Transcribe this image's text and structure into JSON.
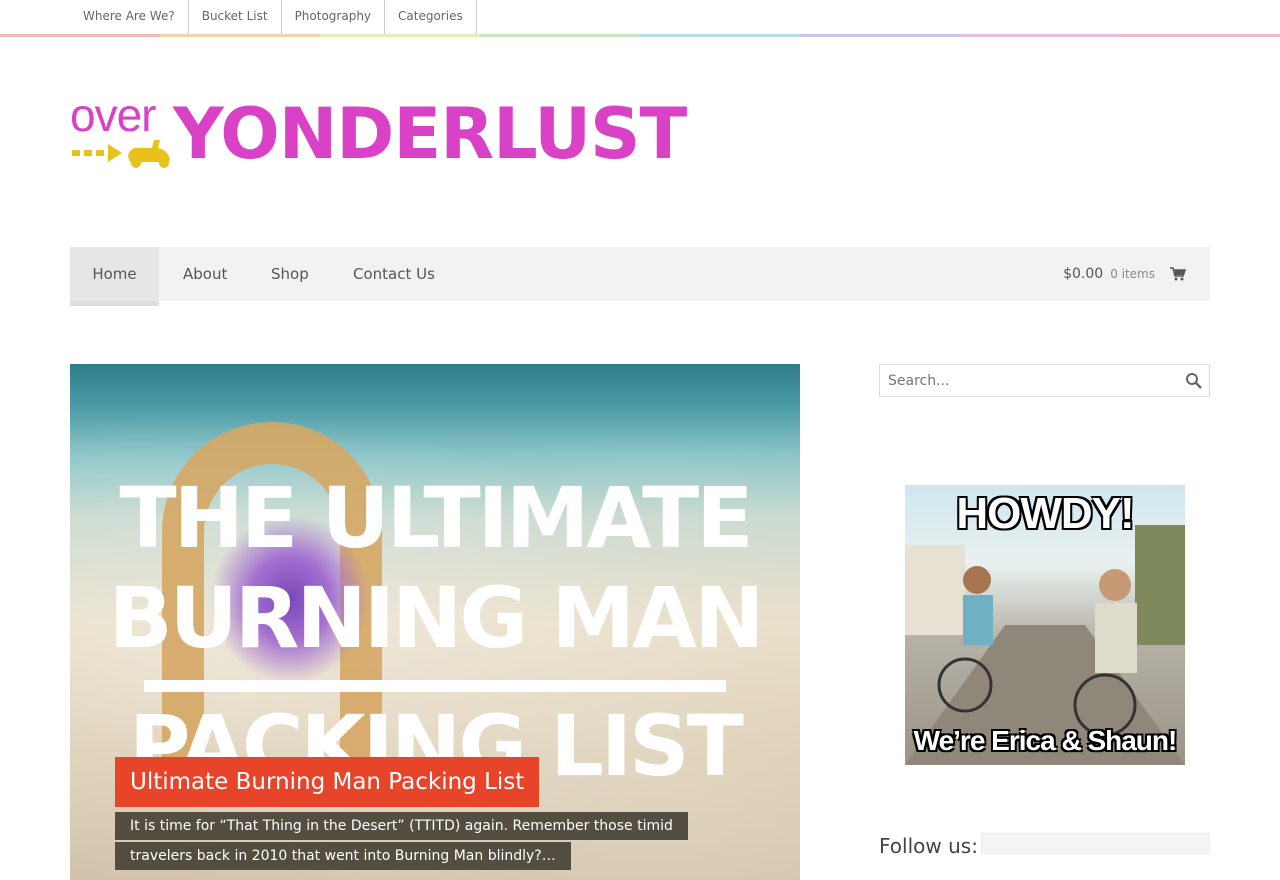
{
  "top_nav": {
    "items": [
      "Where Are We?",
      "Bucket List",
      "Photography",
      "Categories"
    ],
    "stripe_colors": [
      "#f6b7b7",
      "#f5d3a9",
      "#e9ecb0",
      "#c4e7bf",
      "#b6dfe6",
      "#c8c2ec",
      "#e6bfe9",
      "#f5b8c9"
    ]
  },
  "logo": {
    "prefix": "over",
    "main": "YONDERLUST",
    "pink": "#d941c6",
    "yellow": "#e8c21a"
  },
  "main_nav": {
    "items": [
      "Home",
      "About",
      "Shop",
      "Contact Us"
    ],
    "active": "Home",
    "cart_total": "$0.00",
    "cart_items": "0 items"
  },
  "hero": {
    "image_lines": [
      "THE ULTIMATE",
      "BURNING MAN",
      "PACKING LIST"
    ],
    "title": "Ultimate Burning Man Packing List",
    "excerpt_line1": "It is time for “That Thing in the Desert” (TTITD) again. Remember those timid",
    "excerpt_line2": "travelers back in 2010 that went into Burning Man blindly?…",
    "accent": "#e8442a"
  },
  "sidebar": {
    "search_placeholder": "Search...",
    "howdy_top": "HOWDY!",
    "howdy_bottom": "We’re Erica & Shaun!",
    "follow_label": "Follow us:"
  }
}
